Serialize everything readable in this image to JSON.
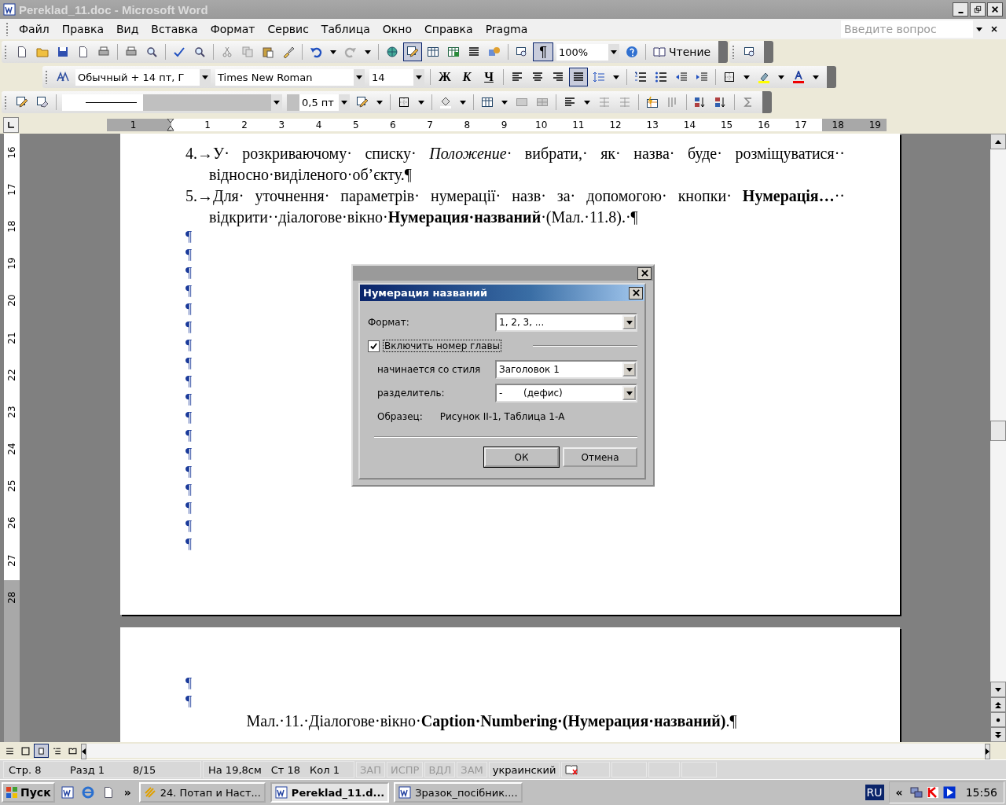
{
  "window": {
    "title": "Pereklad_11.doc - Microsoft Word"
  },
  "menu": [
    "Файл",
    "Правка",
    "Вид",
    "Вставка",
    "Формат",
    "Сервис",
    "Таблица",
    "Окно",
    "Справка",
    "Pragma"
  ],
  "help_search": {
    "placeholder": "Введите вопрос"
  },
  "standard_toolbar": {
    "tables_borders": {
      "selected": true
    },
    "show_formatting": {
      "label": "¶",
      "selected": true
    },
    "zoom": "100%",
    "reading": "Чтение"
  },
  "formatting_toolbar": {
    "style": "Обычный + 14 пт, Г",
    "font": "Times New Roman",
    "size": "14",
    "bold": "Ж",
    "italic": "К",
    "underline": "Ч",
    "alignment_buttons": [
      {
        "selected": false
      },
      {
        "selected": false
      },
      {
        "selected": false
      },
      {
        "selected": true
      }
    ]
  },
  "tables_toolbar": {
    "line_weight": "0,5 пт"
  },
  "ruler": {
    "horizontal": [
      "1",
      "1",
      "2",
      "3",
      "4",
      "5",
      "6",
      "7",
      "8",
      "9",
      "10",
      "11",
      "12",
      "13",
      "14",
      "15",
      "16",
      "17",
      "18",
      "19"
    ],
    "vertical": [
      "16",
      "17",
      "18",
      "19",
      "20",
      "21",
      "22",
      "23",
      "24",
      "25",
      "26",
      "27",
      "28"
    ]
  },
  "document": {
    "page_1": [
      {
        "kind": "item",
        "text": "4.→У· розкриваючому· списку· *Положение*· вибрати,· як· назва· буде· розміщуватися·· відносно·виділеного·об’єкту.¶"
      },
      {
        "kind": "item",
        "text": "5.→Для· уточнення· параметрів· нумерації· назв· за· допомогою· кнопки· **Нумерація…**·· відкрити··діалогове·вікно·**Нумерация·названий**·(Мал.·11.8).·¶"
      },
      {
        "kind": "empty",
        "text": "¶"
      },
      {
        "kind": "empty",
        "text": "¶"
      },
      {
        "kind": "empty",
        "text": "¶"
      },
      {
        "kind": "empty",
        "text": "¶"
      },
      {
        "kind": "empty",
        "text": "¶"
      },
      {
        "kind": "empty",
        "text": "¶"
      },
      {
        "kind": "empty",
        "text": "¶"
      },
      {
        "kind": "empty",
        "text": "¶"
      },
      {
        "kind": "empty",
        "text": "¶"
      },
      {
        "kind": "empty",
        "text": "¶"
      },
      {
        "kind": "empty",
        "text": "¶"
      },
      {
        "kind": "empty",
        "text": "¶"
      },
      {
        "kind": "empty",
        "text": "¶"
      },
      {
        "kind": "empty",
        "text": "¶"
      },
      {
        "kind": "empty",
        "text": "¶"
      },
      {
        "kind": "empty",
        "text": "¶"
      },
      {
        "kind": "empty",
        "text": "¶"
      },
      {
        "kind": "empty",
        "text": "¶"
      }
    ],
    "page_2": [
      {
        "kind": "empty",
        "text": "¶"
      },
      {
        "kind": "empty",
        "text": "¶"
      },
      {
        "kind": "caption",
        "text": "Мал.·11.·Діалогове·вікно·**Caption·Numbering·(Нумерация·названий)**.¶"
      }
    ]
  },
  "dialog": {
    "title": "Нумерация названий",
    "format": {
      "label": "Формат:",
      "value": "1, 2, 3, ..."
    },
    "include_chapter": {
      "label": "Включить номер главы",
      "checked": true
    },
    "style": {
      "label": "начинается со стиля",
      "value": "Заголовок 1"
    },
    "separator": {
      "label": "разделитель:",
      "value": "-       (дефис)"
    },
    "sample": {
      "label": "Образец:",
      "value": "Рисунок II-1, Таблица 1-А"
    },
    "buttons": [
      "ОК",
      "Отмена"
    ]
  },
  "status_bar": {
    "fields": [
      "Стр. 8",
      "Разд 1",
      "8/15",
      "На 19,8см",
      "Ст 18",
      "Кол 1"
    ],
    "modes": [
      {
        "label": "ЗАП",
        "disabled": true
      },
      {
        "label": "ИСПР",
        "disabled": true
      },
      {
        "label": "ВДЛ",
        "disabled": true
      },
      {
        "label": "ЗАМ",
        "disabled": true
      }
    ],
    "language": "украинский"
  },
  "taskbar": {
    "start": "Пуск",
    "more": "»",
    "tasks": [
      {
        "label": "24. Потап и Наст...",
        "selected": false
      },
      {
        "label": "Pereklad_11.d...",
        "selected": true
      },
      {
        "label": "Зразок_посібник....",
        "selected": false
      }
    ],
    "language": "RU",
    "tray_expand": "«",
    "clock": "15:56"
  }
}
